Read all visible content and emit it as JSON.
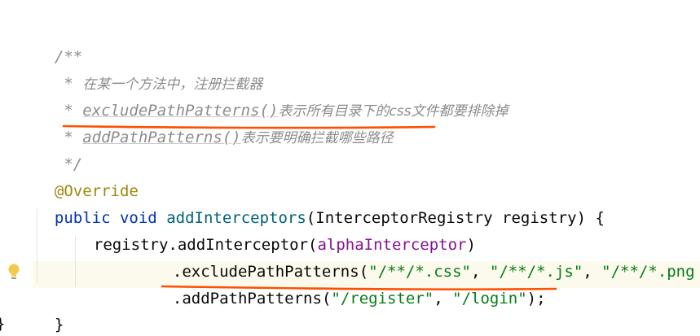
{
  "editor": {
    "lines": {
      "l1": {
        "doc": "/**"
      },
      "l2": {
        "star": " * ",
        "text": "在某一个方法中，注册拦截器"
      },
      "l3": {
        "star": " * ",
        "tag": "excludePathPatterns()",
        "text": "表示所有目录下的css文件都要排除掉"
      },
      "l4": {
        "star": " * ",
        "tag": "addPathPatterns()",
        "text": "表示要明确拦截哪些路径"
      },
      "l5": {
        "doc": " */"
      },
      "l6": {
        "annotation": "@Override"
      },
      "l7": {
        "kw1": "public",
        "kw2": "void",
        "method": "addInterceptors",
        "open": "(",
        "type": "InterceptorRegistry",
        "param": "registry",
        "close": ") {"
      },
      "l8": {
        "obj": "registry",
        "dot": ".",
        "method": "addInterceptor",
        "open": "(",
        "field": "alphaInterceptor",
        "close": ")"
      },
      "l9": {
        "dot": ".",
        "method": "excludePathPatterns",
        "open": "(",
        "s1": "\"/**/*.css\"",
        "comma1": ", ",
        "s2": "\"/**/*.js\"",
        "comma2": ", ",
        "s3": "\"/**/*.png"
      },
      "l10": {
        "dot": ".",
        "method": "addPathPatterns",
        "open": "(",
        "s1": "\"/register\"",
        "comma": ", ",
        "s2": "\"/login\"",
        "close": ");"
      },
      "l11": {
        "brace": "}"
      },
      "l12": {
        "brace": "}"
      }
    },
    "annotation_color": "#ff4f00"
  }
}
